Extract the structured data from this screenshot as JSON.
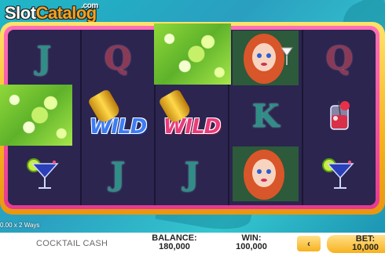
{
  "logo": {
    "part1": "Slot",
    "part2": "Catalog",
    "suffix": ".com"
  },
  "game": {
    "title": "COCKTAIL CASH",
    "ways": "0.00 x 2 Ways"
  },
  "reels": {
    "col1": [
      "J",
      "lime-wild",
      "cocktail-glass"
    ],
    "col2": [
      "Q",
      "WILD",
      "J"
    ],
    "col3": [
      "lime-wild",
      "WILD",
      "J"
    ],
    "col4": [
      "lady",
      "K",
      "lady"
    ],
    "col5": [
      "Q",
      "strawberry-glass",
      "cocktail-glass"
    ]
  },
  "wild_label": "WILD",
  "letters": {
    "j": "J",
    "q": "Q",
    "k": "K"
  },
  "balance": {
    "label": "BALANCE:",
    "value": "180,000"
  },
  "win": {
    "label": "WIN:",
    "value": "100,000"
  },
  "bet": {
    "label": "BET:",
    "value": "10,000"
  },
  "nav": {
    "prev_glyph": "‹"
  },
  "colors": {
    "frame_gold": "#f7b21e",
    "frame_pink": "#e63a92",
    "reel_bg": "#2c2550"
  }
}
